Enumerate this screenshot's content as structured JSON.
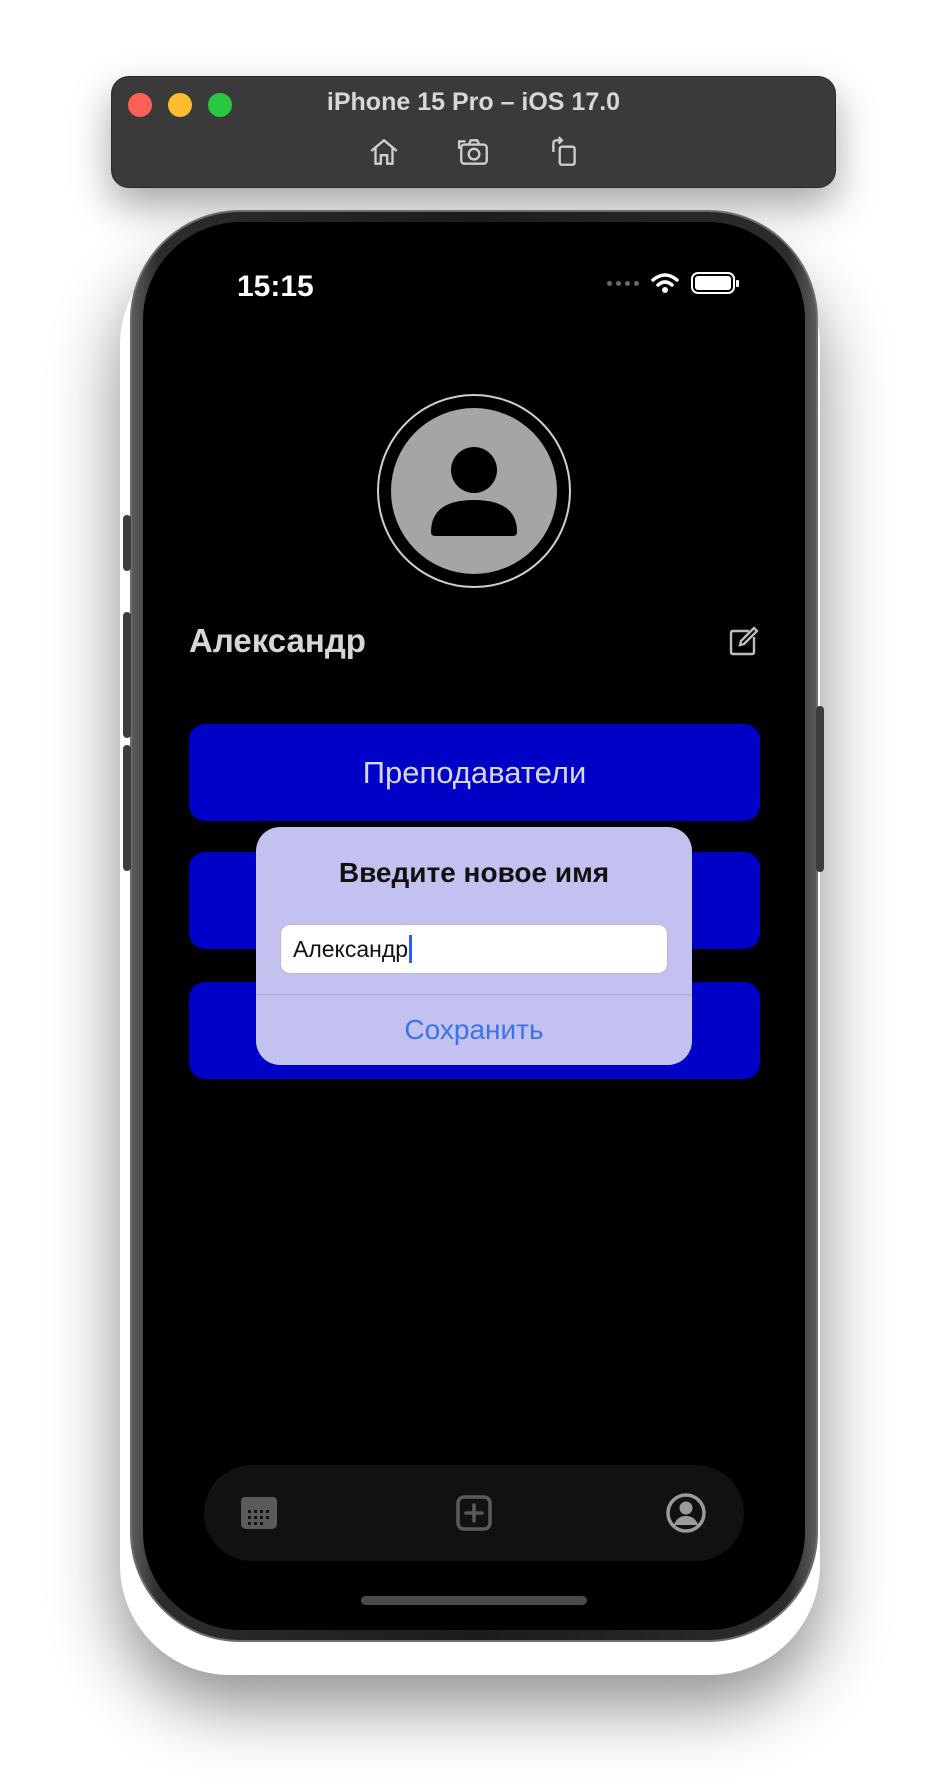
{
  "simulator": {
    "title": "iPhone 15 Pro – iOS 17.0",
    "tools": [
      "home-icon",
      "screenshot-icon",
      "rotate-icon"
    ]
  },
  "status_bar": {
    "time": "15:15"
  },
  "profile": {
    "name": "Александр"
  },
  "menu": {
    "buttons": [
      {
        "label": "Преподаватели"
      },
      {
        "label": ""
      },
      {
        "label": ""
      }
    ]
  },
  "alert": {
    "title": "Введите новое имя",
    "input_value": "Александр",
    "action_label": "Сохранить"
  },
  "tab_bar": {
    "items": [
      "calendar-icon",
      "add-square-icon",
      "profile-circle-icon"
    ],
    "active": "profile-circle-icon"
  },
  "colors": {
    "menu_button": "#0000c7",
    "alert_background": "#c2c1f0",
    "alert_action": "#3c73e8"
  }
}
